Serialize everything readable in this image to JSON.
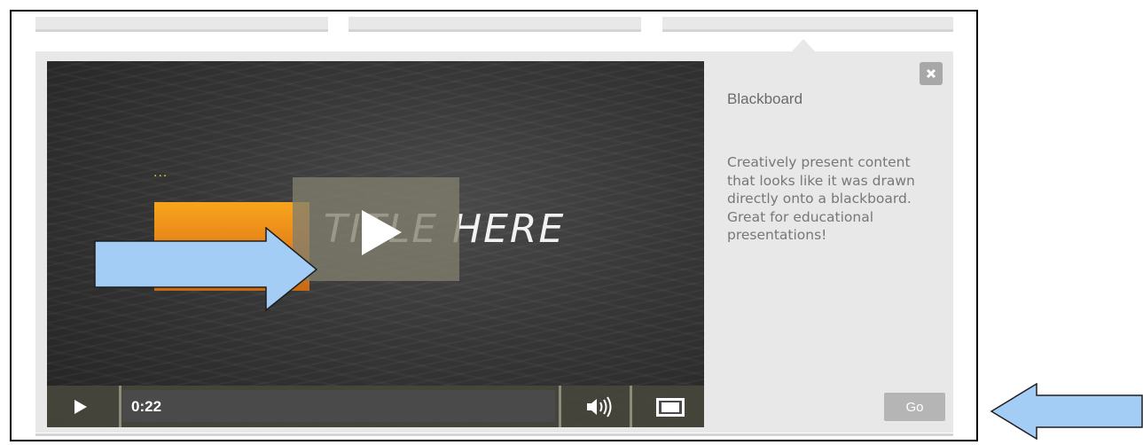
{
  "video": {
    "chalk_title": "TITLE HERE",
    "chalk_dots": "...",
    "current_time": "0:22",
    "icons": {
      "play": "play-icon",
      "volume": "volume-icon",
      "fullscreen": "fullscreen-icon",
      "big_play": "play-icon"
    }
  },
  "info": {
    "title": "Blackboard",
    "description": "Creatively present content that looks like it was drawn directly onto a blackboard. Great for educational presentations!",
    "go_label": "Go",
    "close_icon": "close-icon"
  },
  "annotations": {
    "arrow_color": "#a4cdf6",
    "arrow_stroke": "#1e1e1e"
  }
}
